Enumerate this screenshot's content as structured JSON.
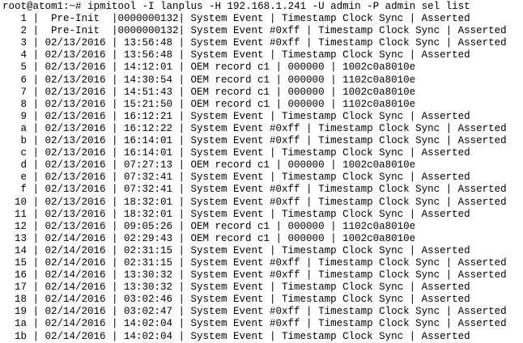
{
  "terminal": {
    "prompt": "root@atom1:~# ",
    "command": "ipmitool -I lanplus -H 192.168.1.241 -U admin -P admin sel list",
    "rows": [
      "   1 |  Pre-Init  |0000000132| System Event | Timestamp Clock Sync | Asserted",
      "   2 |  Pre-Init  |0000000132| System Event #0xff | Timestamp Clock Sync | Asserted",
      "   3 | 02/13/2016 | 13:56:48 | System Event #0xff | Timestamp Clock Sync | Asserted",
      "   4 | 02/13/2016 | 13:56:48 | System Event | Timestamp Clock Sync | Asserted",
      "   5 | 02/13/2016 | 14:12:01 | OEM record c1 | 000000 | 1002c0a8010e",
      "   6 | 02/13/2016 | 14:30:54 | OEM record c1 | 000000 | 1102c0a8010e",
      "   7 | 02/13/2016 | 14:51:43 | OEM record c1 | 000000 | 1002c0a8010e",
      "   8 | 02/13/2016 | 15:21:50 | OEM record c1 | 000000 | 1102c0a8010e",
      "   9 | 02/13/2016 | 16:12:21 | System Event | Timestamp Clock Sync | Asserted",
      "   a | 02/13/2016 | 16:12:22 | System Event #0xff | Timestamp Clock Sync | Asserted",
      "   b | 02/13/2016 | 16:14:01 | System Event #0xff | Timestamp Clock Sync | Asserted",
      "   c | 02/13/2016 | 16:14:01 | System Event | Timestamp Clock Sync | Asserted",
      "   d | 02/13/2016 | 07:27:13 | OEM record c1 | 000000 | 1002c0a8010e",
      "   e | 02/13/2016 | 07:32:41 | System Event | Timestamp Clock Sync | Asserted",
      "   f | 02/13/2016 | 07:32:41 | System Event #0xff | Timestamp Clock Sync | Asserted",
      "  10 | 02/13/2016 | 18:32:01 | System Event #0xff | Timestamp Clock Sync | Asserted",
      "  11 | 02/13/2016 | 18:32:01 | System Event | Timestamp Clock Sync | Asserted",
      "  12 | 02/13/2016 | 09:05:26 | OEM record c1 | 000000 | 1102c0a8010e",
      "  13 | 02/14/2016 | 02:29:43 | OEM record c1 | 000000 | 1002c0a8010e",
      "  14 | 02/14/2016 | 02:31:15 | System Event | Timestamp Clock Sync | Asserted",
      "  15 | 02/14/2016 | 02:31:15 | System Event #0xff | Timestamp Clock Sync | Asserted",
      "  16 | 02/14/2016 | 13:30:32 | System Event #0xff | Timestamp Clock Sync | Asserted",
      "  17 | 02/14/2016 | 13:30:32 | System Event | Timestamp Clock Sync | Asserted",
      "  18 | 02/14/2016 | 03:02:46 | System Event | Timestamp Clock Sync | Asserted",
      "  19 | 02/14/2016 | 03:02:47 | System Event #0xff | Timestamp Clock Sync | Asserted",
      "  1a | 02/14/2016 | 14:02:04 | System Event #0xff | Timestamp Clock Sync | Asserted",
      "  1b | 02/14/2016 | 14:02:04 | System Event | Timestamp Clock Sync | Asserted"
    ]
  }
}
